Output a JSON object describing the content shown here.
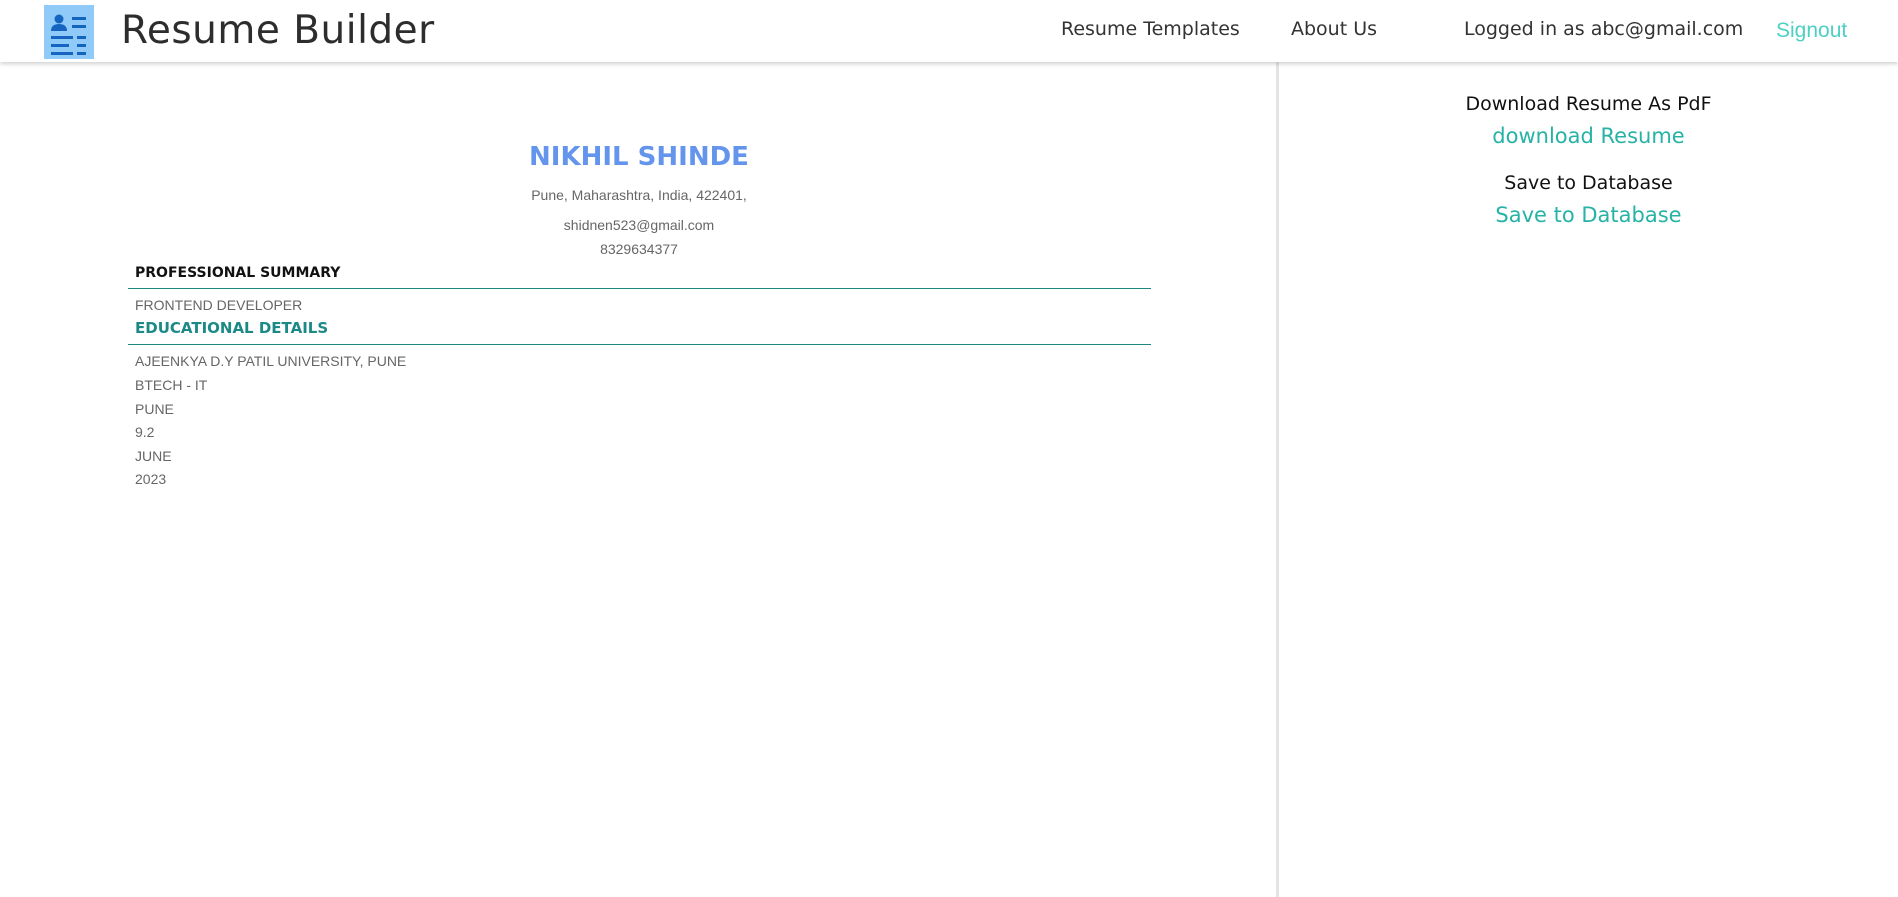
{
  "navbar": {
    "brand": "Resume Builder",
    "links": {
      "templates": "Resume Templates",
      "about": "About Us"
    },
    "user_status": "Logged in as abc@gmail.com",
    "signout": "Signout",
    "logo_icon": "resume-document-icon"
  },
  "resume": {
    "name": "NIKHIL SHINDE",
    "address": "Pune, Maharashtra, India, 422401,",
    "email": "shidnen523@gmail.com",
    "phone": "8329634377",
    "summary": {
      "heading": "PROFESSIONAL SUMMARY",
      "role": "FRONTEND DEVELOPER"
    },
    "education": {
      "heading": "EDUCATIONAL DETAILS",
      "university": "AJEENKYA D.Y PATIL UNIVERSITY, PUNE",
      "degree": "BTECH - IT",
      "city": "PUNE",
      "grade": "9.2",
      "month": "JUNE",
      "year": "2023"
    }
  },
  "sidebar": {
    "download_label": "Download Resume As PdF",
    "download_link": "download Resume",
    "save_label": "Save to Database",
    "save_link": "Save to Database"
  },
  "colors": {
    "accent_teal": "#26b3a6",
    "name_blue": "#6495ed",
    "heading_teal": "#1b8a86",
    "logo_bg": "#90caf9"
  }
}
